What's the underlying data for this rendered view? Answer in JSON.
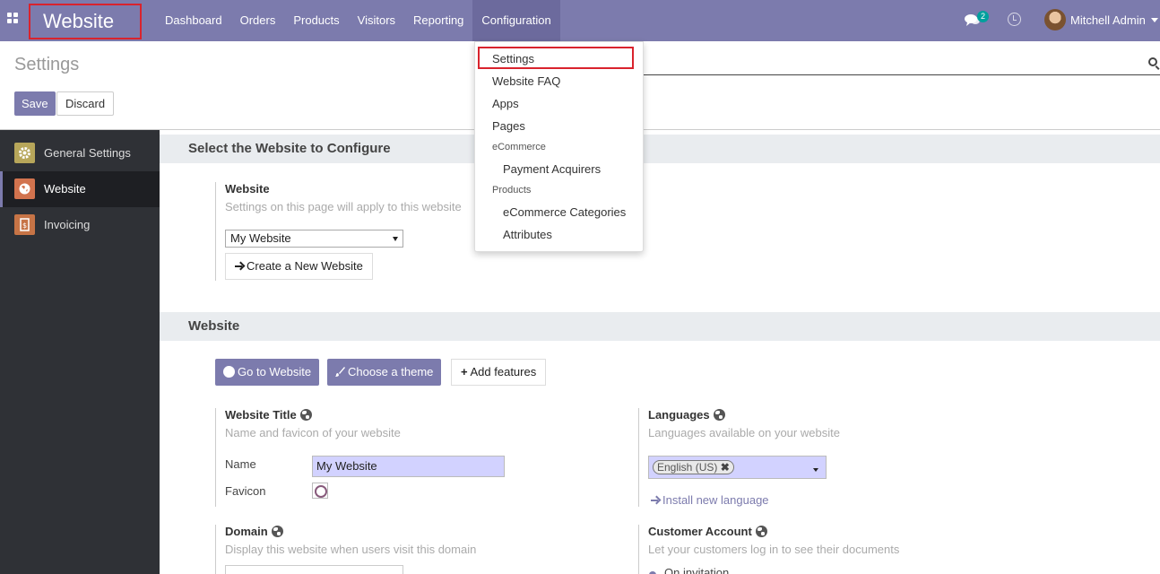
{
  "navbar": {
    "brand": "Website",
    "menu": [
      "Dashboard",
      "Orders",
      "Products",
      "Visitors",
      "Reporting",
      "Configuration"
    ],
    "chat_count": "2",
    "user_name": "Mitchell Admin",
    "accent": "#7c7bad"
  },
  "control_panel": {
    "title": "Settings",
    "save_label": "Save",
    "discard_label": "Discard"
  },
  "sidebar": {
    "items": [
      {
        "label": "General Settings",
        "icon": "gear-icon"
      },
      {
        "label": "Website",
        "icon": "globe-icon"
      },
      {
        "label": "Invoicing",
        "icon": "invoice-icon"
      }
    ]
  },
  "dropdown": {
    "settings": "Settings",
    "website_faq": "Website FAQ",
    "apps": "Apps",
    "pages": "Pages",
    "ecommerce_header": "eCommerce",
    "payment_acquirers": "Payment Acquirers",
    "products_header": "Products",
    "ecommerce_categories": "eCommerce Categories",
    "attributes": "Attributes"
  },
  "section_select": {
    "heading": "Select the Website to Configure",
    "title": "Website",
    "desc": "Settings on this page will apply to this website",
    "selected": "My Website",
    "create_label": "Create a New Website"
  },
  "section_website": {
    "heading": "Website",
    "go_label": "Go to Website",
    "theme_label": "Choose a theme",
    "features_label": "Add features",
    "title_block": {
      "title": "Website Title",
      "desc": "Name and favicon of your website",
      "name_label": "Name",
      "name_value": "My Website",
      "favicon_label": "Favicon"
    },
    "languages_block": {
      "title": "Languages",
      "desc": "Languages available on your website",
      "tag": "English (US)",
      "install_label": "Install new language"
    },
    "domain_block": {
      "title": "Domain",
      "desc": "Display this website when users visit this domain"
    },
    "account_block": {
      "title": "Customer Account",
      "desc": "Let your customers log in to see their documents",
      "option": "On invitation"
    }
  }
}
